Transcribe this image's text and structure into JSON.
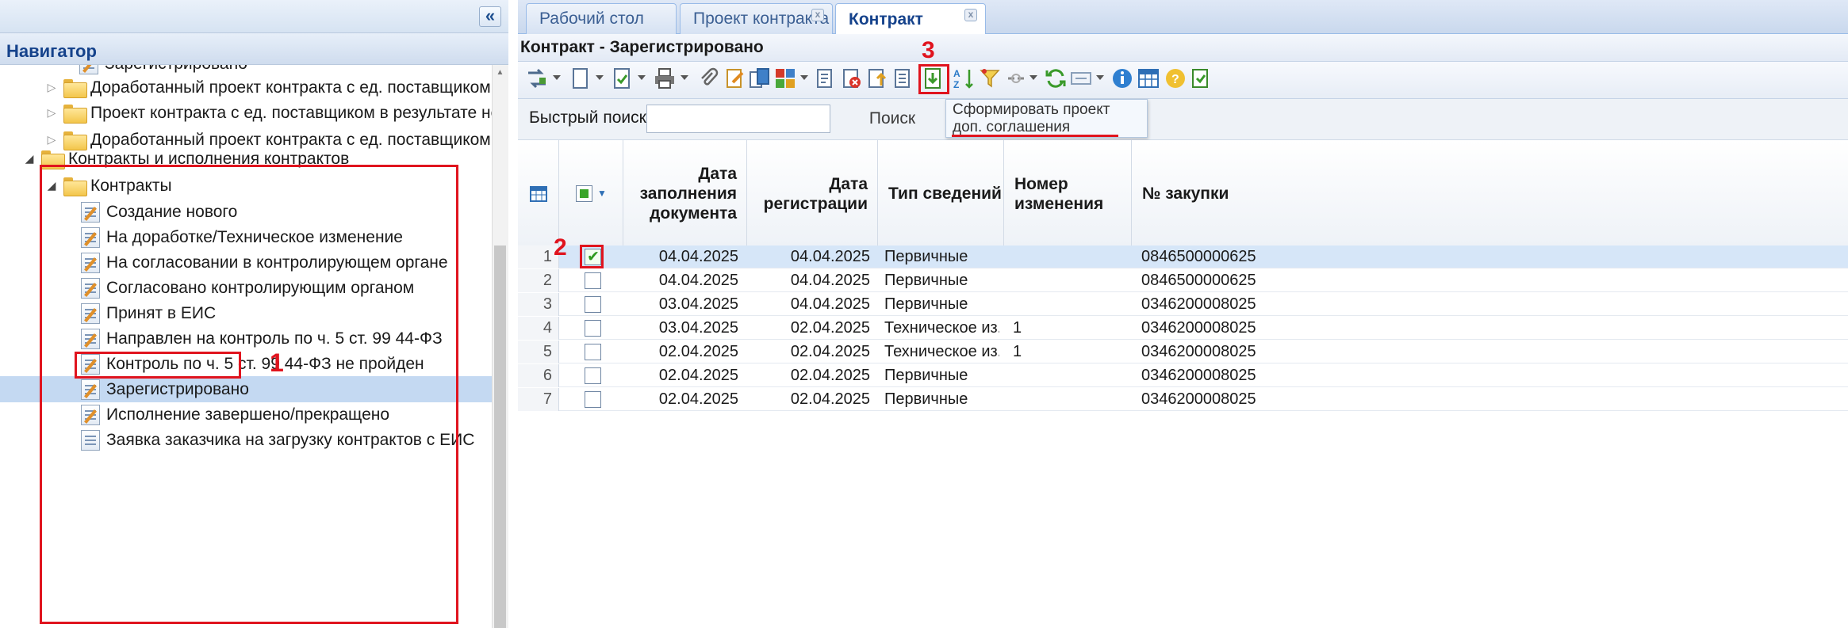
{
  "navigator": {
    "title": "Навигатор",
    "collapse_icon": "«",
    "items": [
      {
        "label": "Зарегистрировано",
        "type": "doc",
        "partial": true
      },
      {
        "label": "Доработанный проект контракта с ед. поставщиком",
        "type": "folder"
      },
      {
        "label": "Проект контракта с ед. поставщиком в результате несостоявше",
        "type": "folder"
      },
      {
        "label": "Доработанный проект контракта с ед. поставщиком в результат",
        "type": "folder"
      },
      {
        "label": "Контракты и исполнения контрактов",
        "type": "folder"
      },
      {
        "label": "Контракты",
        "type": "folder"
      },
      {
        "label": "Создание нового",
        "type": "doc"
      },
      {
        "label": "На доработке/Техническое изменение",
        "type": "doc"
      },
      {
        "label": "На согласовании в контролирующем органе",
        "type": "doc"
      },
      {
        "label": "Согласовано контролирующим органом",
        "type": "doc"
      },
      {
        "label": "Принят в ЕИС",
        "type": "doc"
      },
      {
        "label": "Направлен на контроль по ч. 5 ст. 99 44-ФЗ",
        "type": "doc"
      },
      {
        "label": "Контроль по ч. 5 ст. 99 44-ФЗ не пройден",
        "type": "doc"
      },
      {
        "label": "Зарегистрировано",
        "type": "doc",
        "selected": true
      },
      {
        "label": "Исполнение завершено/прекращено",
        "type": "doc"
      },
      {
        "label": "Заявка заказчика на загрузку контрактов с ЕИС",
        "type": "doc-plain"
      }
    ]
  },
  "tabs": [
    {
      "label": "Рабочий стол"
    },
    {
      "label": "Проект контракта",
      "close": "x"
    },
    {
      "label": "Контракт",
      "close": "x",
      "active": true
    }
  ],
  "panel_title": "Контракт - Зарегистрировано",
  "toolbar": {
    "tooltip": "Сформировать проект доп. соглашения"
  },
  "search": {
    "label": "Быстрый поиск",
    "value": "",
    "button": "Поиск"
  },
  "grid": {
    "columns": {
      "fill_date": "Дата заполнения документа",
      "reg_date": "Дата регистрации",
      "type": "Тип сведений",
      "change_num": "Номер изменения",
      "purchase": "№ закупки"
    },
    "rows": [
      {
        "n": "1",
        "checked": true,
        "fill": "04.04.2025",
        "reg": "04.04.2025",
        "type": "Первичные",
        "change": "",
        "purchase": "0846500000625"
      },
      {
        "n": "2",
        "checked": false,
        "fill": "04.04.2025",
        "reg": "04.04.2025",
        "type": "Первичные",
        "change": "",
        "purchase": "0846500000625"
      },
      {
        "n": "3",
        "checked": false,
        "fill": "03.04.2025",
        "reg": "04.04.2025",
        "type": "Первичные",
        "change": "",
        "purchase": "0346200008025"
      },
      {
        "n": "4",
        "checked": false,
        "fill": "03.04.2025",
        "reg": "02.04.2025",
        "type": "Техническое из...",
        "change": "1",
        "purchase": "0346200008025"
      },
      {
        "n": "5",
        "checked": false,
        "fill": "02.04.2025",
        "reg": "02.04.2025",
        "type": "Техническое из...",
        "change": "1",
        "purchase": "0346200008025"
      },
      {
        "n": "6",
        "checked": false,
        "fill": "02.04.2025",
        "reg": "02.04.2025",
        "type": "Первичные",
        "change": "",
        "purchase": "0346200008025"
      },
      {
        "n": "7",
        "checked": false,
        "fill": "02.04.2025",
        "reg": "02.04.2025",
        "type": "Первичные",
        "change": "",
        "purchase": "0346200008025"
      }
    ]
  },
  "annotations": {
    "one": "1",
    "two": "2",
    "three": "3"
  },
  "colors": {
    "annotation": "#e0141e",
    "header": "#15428b",
    "selection": "#c4d9f2"
  }
}
